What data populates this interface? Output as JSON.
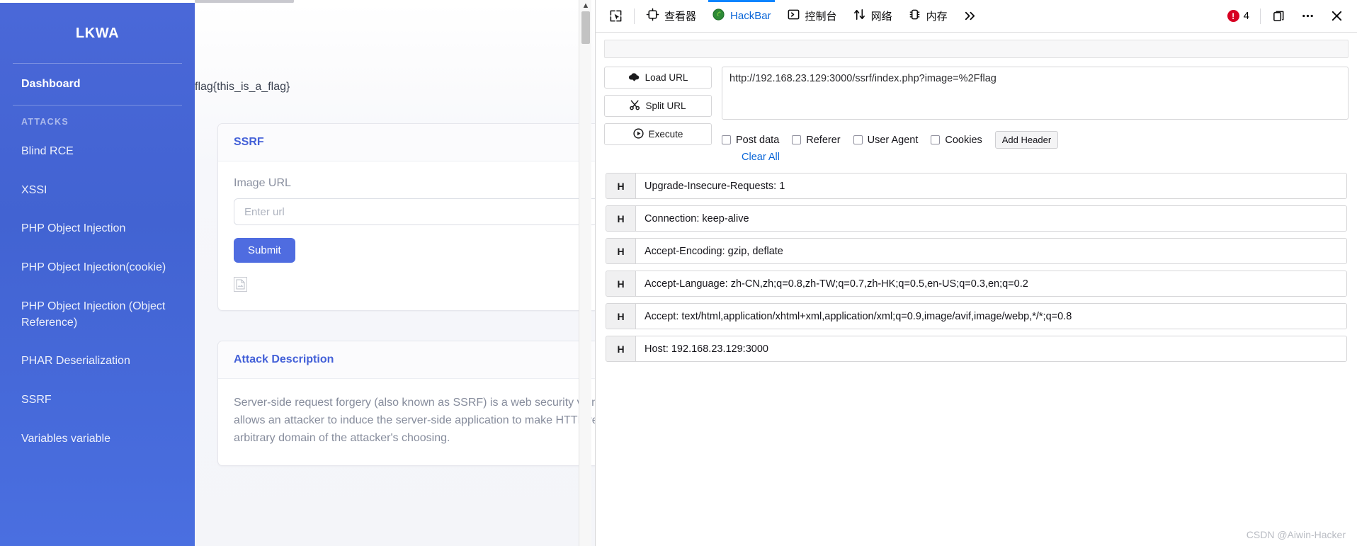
{
  "sidebar": {
    "brand": "LKWA",
    "dashboard_label": "Dashboard",
    "section_heading": "ATTACKS",
    "items": [
      {
        "label": "Blind RCE"
      },
      {
        "label": "XSSI"
      },
      {
        "label": "PHP Object Injection"
      },
      {
        "label": "PHP Object Injection(cookie)"
      },
      {
        "label": "PHP Object Injection (Object Reference)"
      },
      {
        "label": "PHAR Deserialization"
      },
      {
        "label": "SSRF"
      },
      {
        "label": "Variables variable"
      }
    ]
  },
  "page": {
    "flag_text": "flag{this_is_a_flag}",
    "ssrf_card": {
      "title": "SSRF",
      "field_label": "Image URL",
      "input_value": "",
      "input_placeholder": "Enter url",
      "submit_label": "Submit",
      "broken_image_icon": "broken-image-icon"
    },
    "description_card": {
      "title": "Attack Description",
      "body": "Server-side request forgery (also known as SSRF) is a web security vulnerability that allows an attacker to induce the server-side application to make HTTP requests to an arbitrary domain of the attacker's choosing."
    }
  },
  "devtools": {
    "tabs": [
      {
        "label": "查看器",
        "icon": "inspector-target-icon",
        "active": false
      },
      {
        "label": "HackBar",
        "icon": "hackbar-firefox-icon",
        "active": true
      },
      {
        "label": "控制台",
        "icon": "console-chevron-icon",
        "active": false
      },
      {
        "label": "网络",
        "icon": "network-arrows-icon",
        "active": false
      },
      {
        "label": "内存",
        "icon": "memory-chip-icon",
        "active": false
      }
    ],
    "picker_icon": "element-picker-icon",
    "overflow_icon": "chevron-double-right-icon",
    "error_count": "4",
    "dock_icon": "dock-panel-icon",
    "meatball_icon": "more-options-icon",
    "close_icon": "close-icon",
    "hackbar": {
      "load_url_label": "Load URL",
      "split_url_label": "Split URL",
      "execute_label": "Execute",
      "load_url_icon": "cloud-download-icon",
      "split_url_icon": "scissors-icon",
      "execute_icon": "play-circle-icon",
      "url_value": "http://192.168.23.129:3000/ssrf/index.php?image=%2Fflag",
      "options": [
        {
          "label": "Post data",
          "checked": false
        },
        {
          "label": "Referer",
          "checked": false
        },
        {
          "label": "User Agent",
          "checked": false
        },
        {
          "label": "Cookies",
          "checked": false
        }
      ],
      "add_header_label": "Add Header",
      "clear_all_label": "Clear All",
      "header_key_badge": "H",
      "headers": [
        {
          "value": "Upgrade-Insecure-Requests: 1"
        },
        {
          "value": "Connection: keep-alive"
        },
        {
          "value": "Accept-Encoding: gzip, deflate"
        },
        {
          "value": "Accept-Language: zh-CN,zh;q=0.8,zh-TW;q=0.7,zh-HK;q=0.5,en-US;q=0.3,en;q=0.2"
        },
        {
          "value": "Accept: text/html,application/xhtml+xml,application/xml;q=0.9,image/avif,image/webp,*/*;q=0.8"
        },
        {
          "value": "Host: 192.168.23.129:3000"
        }
      ]
    }
  },
  "watermark": "CSDN @Aiwin-Hacker",
  "colors": {
    "brand_blue": "#4263d2",
    "accent_link": "#4360d8",
    "devtools_active": "#0a66d8",
    "error_red": "#d70022"
  }
}
